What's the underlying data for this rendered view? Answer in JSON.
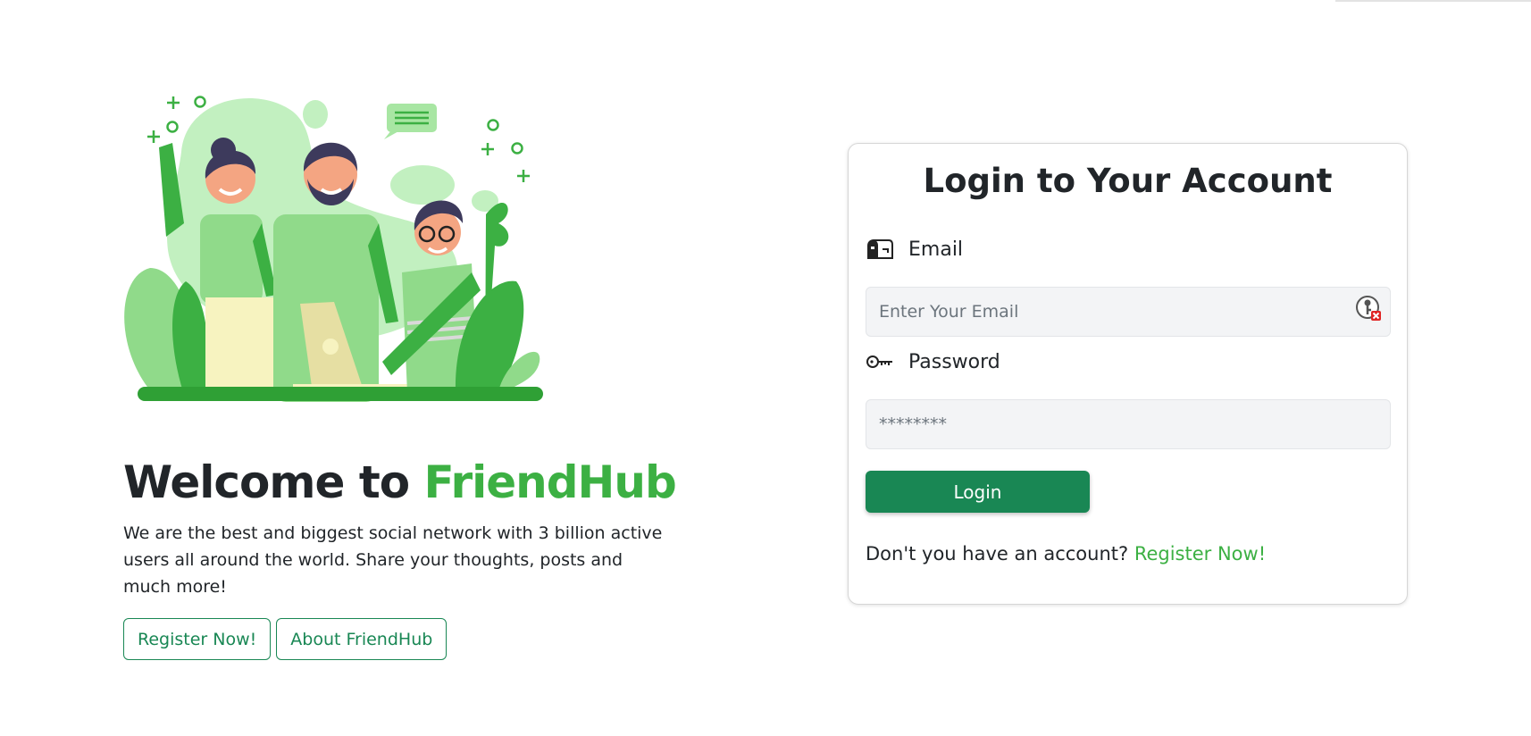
{
  "hero": {
    "title_prefix": "Welcome to",
    "title_brand": "FriendHub",
    "description": "We are the best and biggest social network with 3 billion active users all around the world. Share your thoughts, posts and much more!",
    "buttons": {
      "register": "Register Now!",
      "about": "About FriendHub"
    }
  },
  "login": {
    "title": "Login to Your Account",
    "email": {
      "label": "Email",
      "placeholder": "Enter Your Email",
      "icon": "mailbox-icon"
    },
    "password": {
      "label": "Password",
      "value": "********",
      "icon": "key-icon"
    },
    "submit_label": "Login",
    "signup_prompt": "Don't you have an account?",
    "signup_link": "Register Now!"
  },
  "colors": {
    "brand_green": "#3cb043",
    "button_green": "#198754",
    "input_bg": "#f3f4f6"
  }
}
